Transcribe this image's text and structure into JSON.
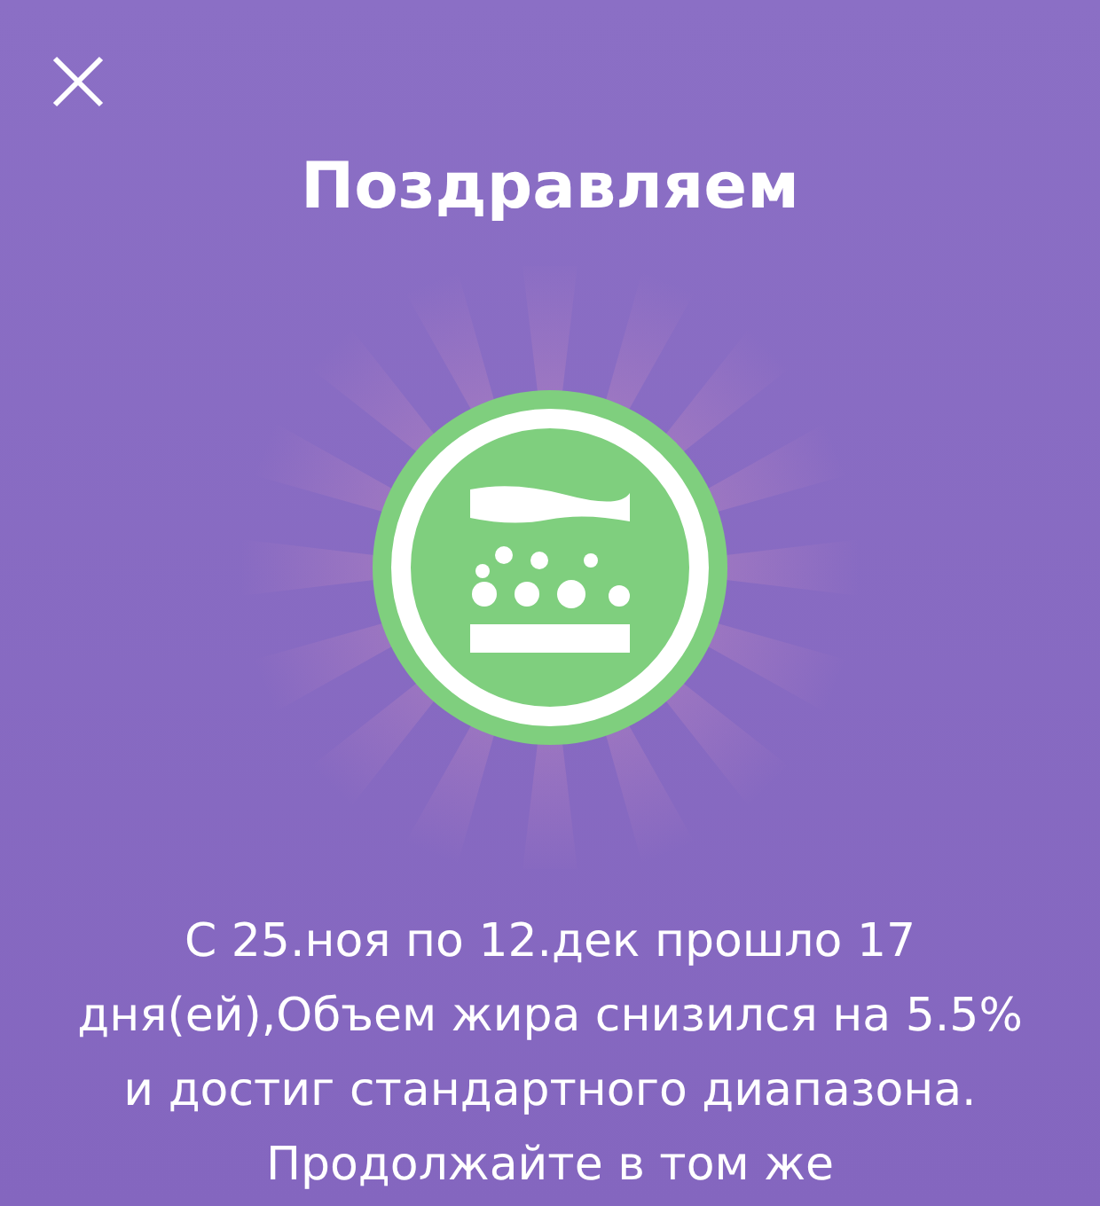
{
  "title": "Поздравляем",
  "message": "С 25.ноя по 12.дек прошло 17 дня(ей),Объем жира снизился на 5.5% и достиг стандартного диапазона. Продолжайте в том же"
}
